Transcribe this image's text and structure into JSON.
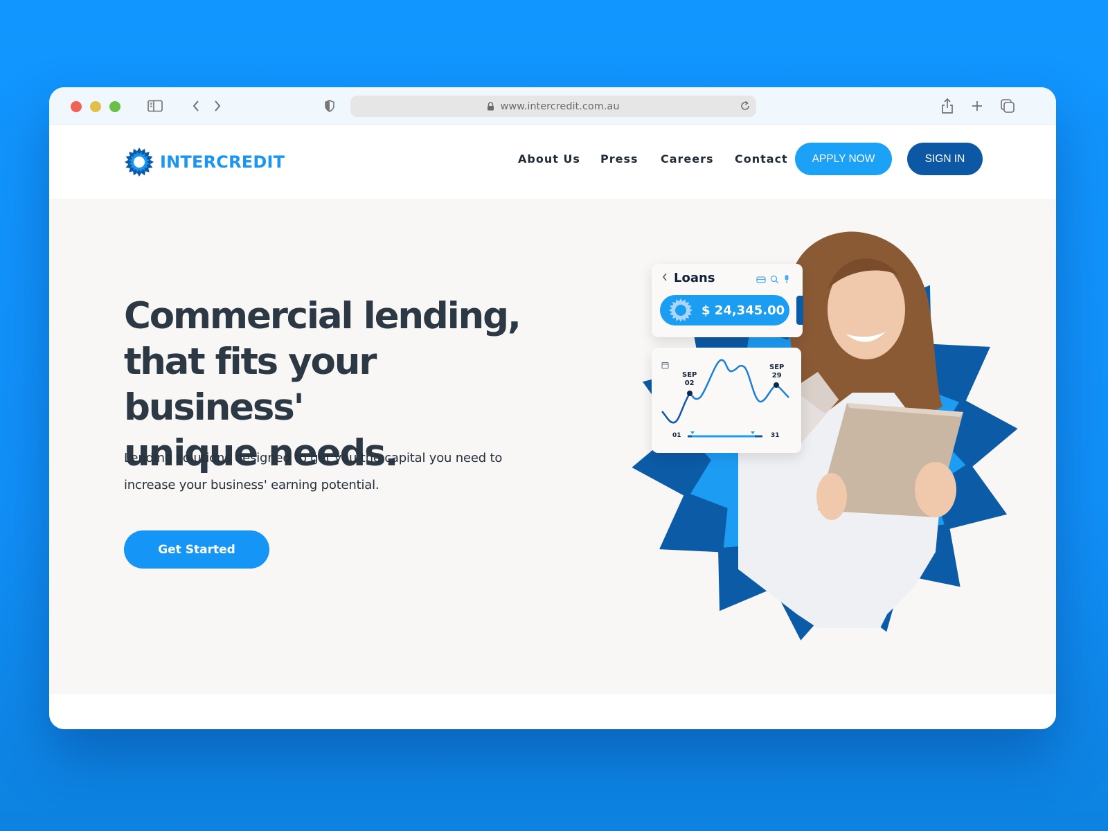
{
  "browser": {
    "url": "www.intercredit.com.au",
    "icons": [
      "sidebar-icon",
      "back-icon",
      "forward-icon",
      "shield-icon",
      "lock-icon",
      "reload-icon",
      "share-icon",
      "new-tab-icon",
      "tabs-overview-icon"
    ]
  },
  "site": {
    "brand": "INTERCREDIT",
    "nav": [
      {
        "label": "About Us"
      },
      {
        "label": "Press"
      },
      {
        "label": "Careers"
      },
      {
        "label": "Contact"
      }
    ],
    "apply_label": "APPLY NOW",
    "signin_label": "SIGN IN"
  },
  "hero": {
    "title_lines": [
      "Commercial lending,",
      "that fits your business'",
      "unique needs."
    ],
    "subtitle_lines": [
      "Lending solutions designed to get you the capital you need to",
      "increase your business' earning potential."
    ],
    "cta_label": "Get Started"
  },
  "widget": {
    "loans_title": "Loans",
    "amount": "$ 24,345.00",
    "marker_start": {
      "month": "SEP",
      "day": "02"
    },
    "marker_end": {
      "month": "SEP",
      "day": "29"
    },
    "range_start": "01",
    "range_end": "31"
  },
  "colors": {
    "brand_blue": "#1a96f0",
    "dark_blue": "#0c58a5",
    "page_bg": "#1196ff",
    "hero_bg": "#f8f7f5"
  }
}
